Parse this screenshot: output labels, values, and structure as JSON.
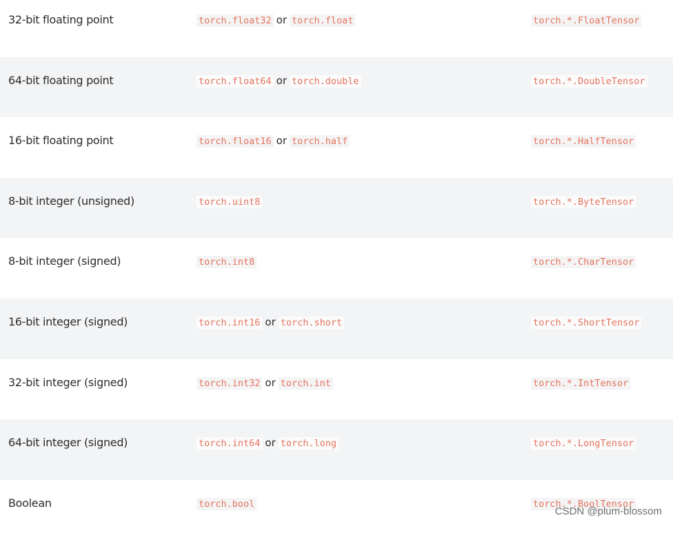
{
  "rows": [
    {
      "type": "32-bit floating point",
      "dtypes": [
        "torch.float32",
        "torch.float"
      ],
      "tensor": "torch.*.FloatTensor"
    },
    {
      "type": "64-bit floating point",
      "dtypes": [
        "torch.float64",
        "torch.double"
      ],
      "tensor": "torch.*.DoubleTensor"
    },
    {
      "type": "16-bit floating point",
      "dtypes": [
        "torch.float16",
        "torch.half"
      ],
      "tensor": "torch.*.HalfTensor"
    },
    {
      "type": "8-bit integer (unsigned)",
      "dtypes": [
        "torch.uint8"
      ],
      "tensor": "torch.*.ByteTensor"
    },
    {
      "type": "8-bit integer (signed)",
      "dtypes": [
        "torch.int8"
      ],
      "tensor": "torch.*.CharTensor"
    },
    {
      "type": "16-bit integer (signed)",
      "dtypes": [
        "torch.int16",
        "torch.short"
      ],
      "tensor": "torch.*.ShortTensor"
    },
    {
      "type": "32-bit integer (signed)",
      "dtypes": [
        "torch.int32",
        "torch.int"
      ],
      "tensor": "torch.*.IntTensor"
    },
    {
      "type": "64-bit integer (signed)",
      "dtypes": [
        "torch.int64",
        "torch.long"
      ],
      "tensor": "torch.*.LongTensor"
    },
    {
      "type": "Boolean",
      "dtypes": [
        "torch.bool"
      ],
      "tensor": "torch.*.BoolTensor"
    }
  ],
  "or_label": "or",
  "watermark": "CSDN @plum-blossom",
  "colors": {
    "code_text": "#e4735f",
    "stripe": "#f3f4f6"
  }
}
